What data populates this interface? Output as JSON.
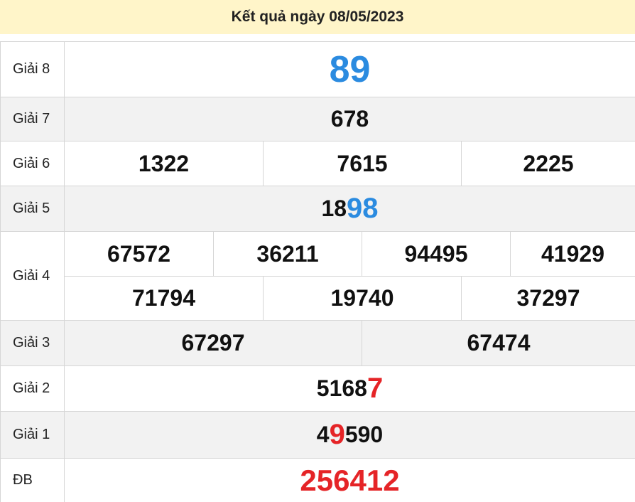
{
  "header": {
    "title": "Kết quả ngày 08/05/2023"
  },
  "prizes": {
    "g8": {
      "label": "Giải 8",
      "values": [
        "89"
      ]
    },
    "g7": {
      "label": "Giải 7",
      "values": [
        "678"
      ]
    },
    "g6": {
      "label": "Giải 6",
      "values": [
        "1322",
        "7615",
        "2225"
      ]
    },
    "g5": {
      "label": "Giải 5",
      "plain": "18",
      "highlight": "98"
    },
    "g4": {
      "label": "Giải 4",
      "row1": [
        "67572",
        "36211",
        "94495",
        "41929"
      ],
      "row2": [
        "71794",
        "19740",
        "37297"
      ]
    },
    "g3": {
      "label": "Giải 3",
      "values": [
        "67297",
        "67474"
      ]
    },
    "g2": {
      "label": "Giải 2",
      "plain": "5168",
      "highlight": "7"
    },
    "g1": {
      "label": "Giải 1",
      "before": "4",
      "highlight": "9",
      "after": "590"
    },
    "db": {
      "label": "ĐB",
      "values": [
        "256412"
      ]
    }
  },
  "colors": {
    "header_bg": "#fff5c9",
    "blue": "#2b8be0",
    "red": "#e52427",
    "row_alt": "#f2f2f2"
  }
}
